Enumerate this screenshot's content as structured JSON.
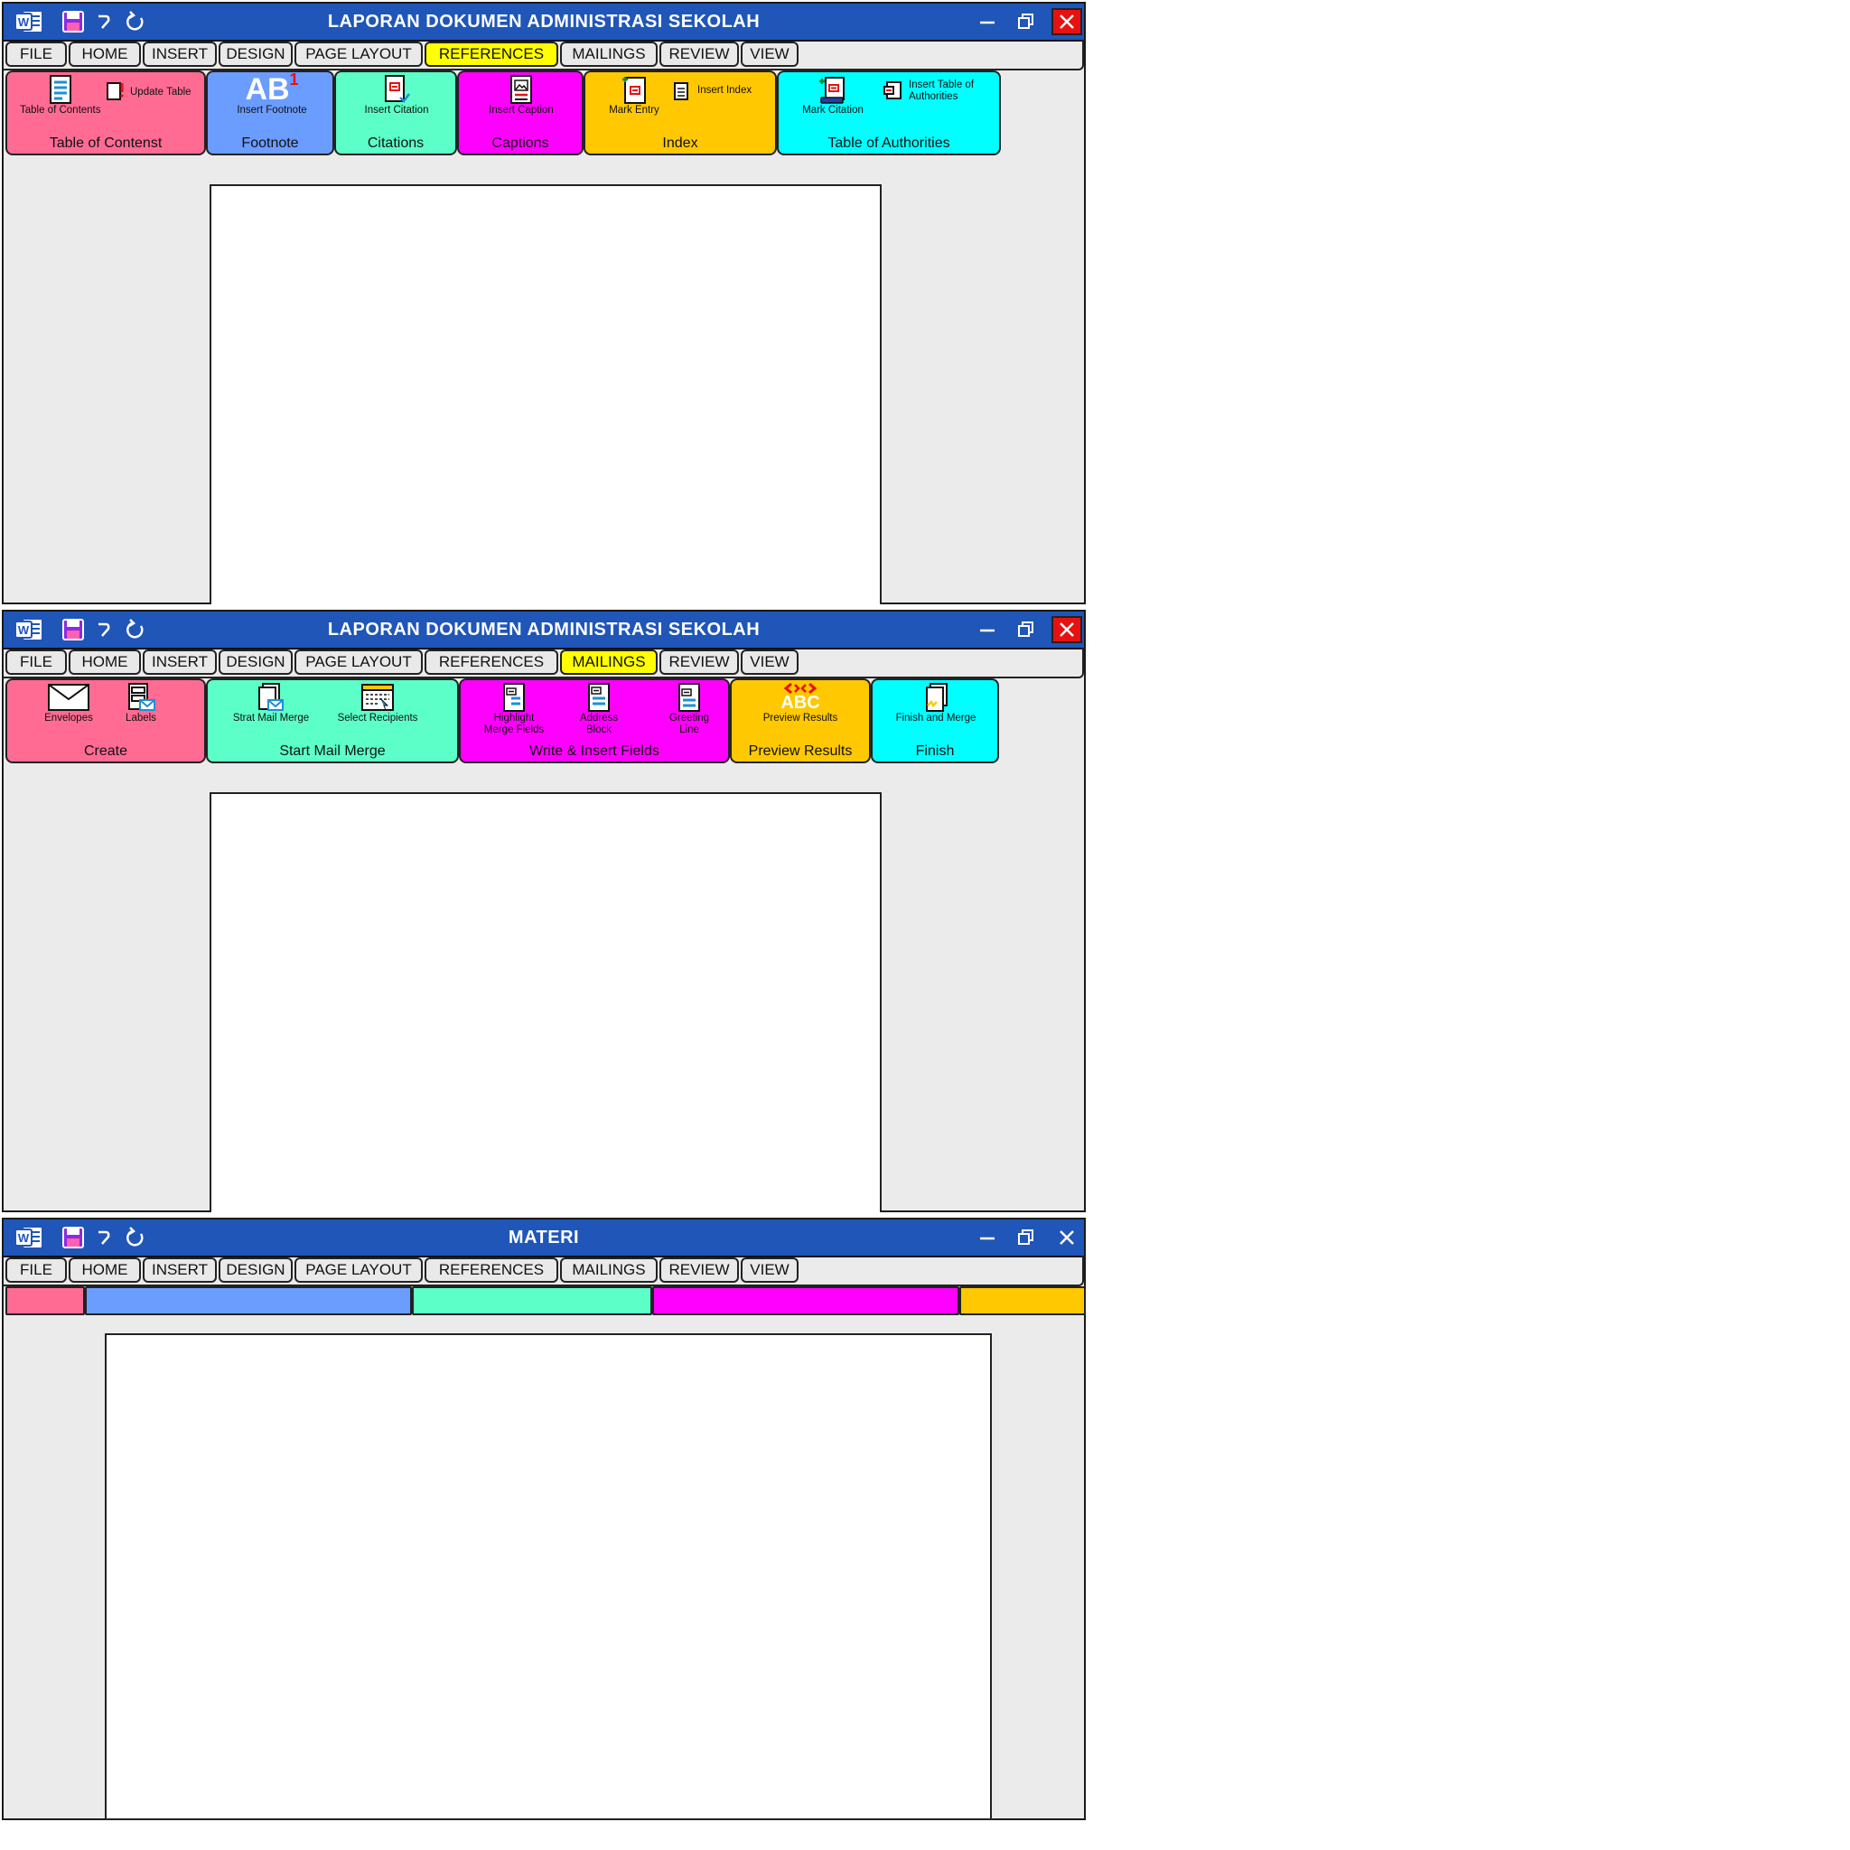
{
  "windows": [
    {
      "title": "LAPORAN DOKUMEN ADMINISTRASI SEKOLAH",
      "tabs": [
        "FILE",
        "HOME",
        "INSERT",
        "DESIGN",
        "PAGE LAYOUT",
        "REFERENCES",
        "MAILINGS",
        "REVIEW",
        "VIEW"
      ],
      "active_tab": "REFERENCES",
      "groups": [
        {
          "label": "Table of Contenst",
          "color": "#ff6b93",
          "buttons": [
            "Table of Contents",
            "Update Table"
          ]
        },
        {
          "label": "Footnote",
          "color": "#6b9cff",
          "buttons": [
            "Insert Footnote"
          ],
          "icon_text": "AB",
          "icon_sup": "1"
        },
        {
          "label": "Citations",
          "color": "#5cffc8",
          "buttons": [
            "Insert Citation"
          ]
        },
        {
          "label": "Captions",
          "color": "#ff00ff",
          "buttons": [
            "Insert Caption"
          ]
        },
        {
          "label": "Index",
          "color": "#ffc800",
          "buttons": [
            "Mark Entry",
            "Insert Index"
          ]
        },
        {
          "label": "Table of Authorities",
          "color": "#00ffff",
          "buttons": [
            "Mark Citation",
            "Insert Table of Authorities"
          ]
        }
      ]
    },
    {
      "title": "LAPORAN DOKUMEN ADMINISTRASI SEKOLAH",
      "tabs": [
        "FILE",
        "HOME",
        "INSERT",
        "DESIGN",
        "PAGE LAYOUT",
        "REFERENCES",
        "MAILINGS",
        "REVIEW",
        "VIEW"
      ],
      "active_tab": "MAILINGS",
      "groups": [
        {
          "label": "Create",
          "color": "#ff6b93",
          "buttons": [
            "Envelopes",
            "Labels"
          ]
        },
        {
          "label": "Start Mail Merge",
          "color": "#5cffc8",
          "buttons": [
            "Strat Mail Merge",
            "Select Recipients"
          ]
        },
        {
          "label": "Write & Insert Fields",
          "color": "#ff00ff",
          "buttons": [
            "Highlight Merge Fields",
            "Address Block",
            "Greeting Line"
          ]
        },
        {
          "label": "Preview Results",
          "color": "#ffc800",
          "buttons": [
            "Preview Results"
          ],
          "icon_text": "ABC"
        },
        {
          "label": "Finish",
          "color": "#00ffff",
          "buttons": [
            "Finish and Merge"
          ]
        }
      ]
    },
    {
      "title": "MATERI",
      "tabs": [
        "FILE",
        "HOME",
        "INSERT",
        "DESIGN",
        "PAGE LAYOUT",
        "REFERENCES",
        "MAILINGS",
        "REVIEW",
        "VIEW"
      ],
      "active_tab": "",
      "bands": [
        "#ff6b93",
        "#6b9cff",
        "#5cffc8",
        "#ff00ff",
        "#ffc800"
      ]
    }
  ]
}
